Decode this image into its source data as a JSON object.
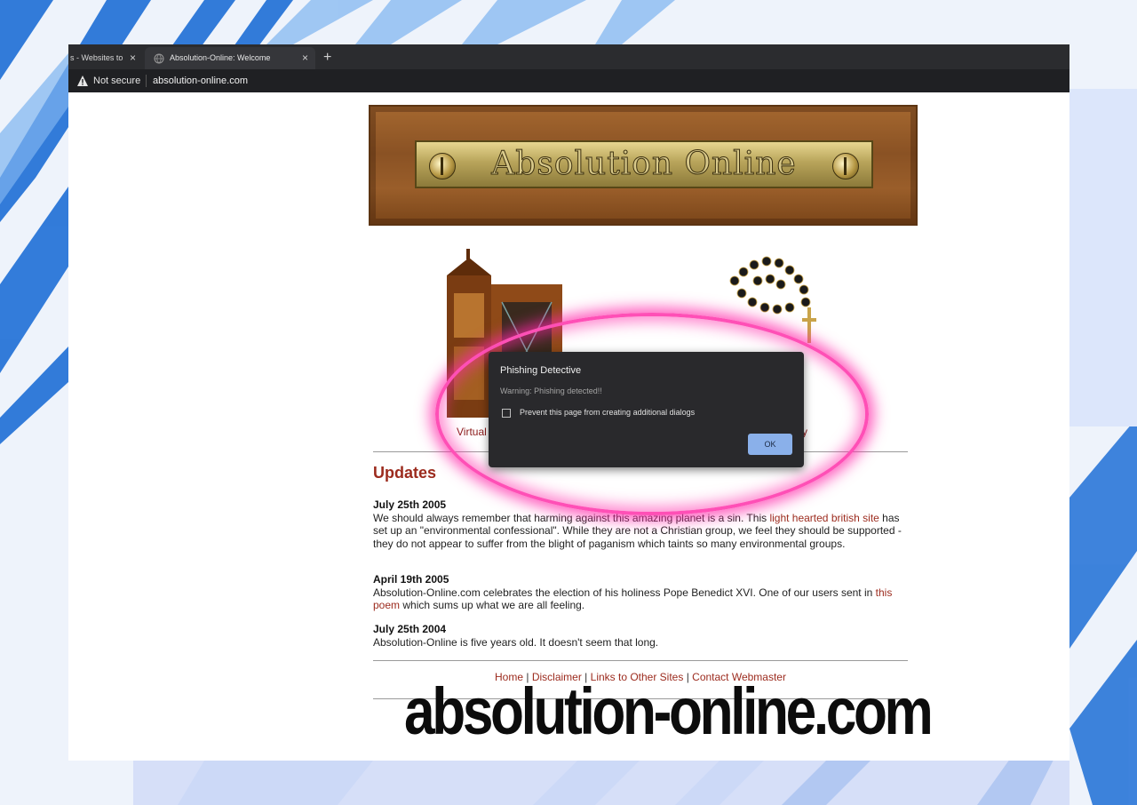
{
  "browser": {
    "tabs": [
      {
        "label": "s - Websites to",
        "active": false
      },
      {
        "label": "Absolution-Online: Welcome",
        "active": true
      }
    ],
    "new_tab_symbol": "+",
    "close_symbol": "×",
    "security_label": "Not secure",
    "url": "absolution-online.com"
  },
  "page": {
    "banner_title": "Absolution Online",
    "caption_left": "Virtual",
    "caption_right": "y",
    "updates_heading": "Updates",
    "entries": [
      {
        "date": "July 25th 2005",
        "text_before": "We should always remember that harming against this amazing planet is a sin. This ",
        "link": "light hearted british site",
        "text_after": " has set up an \"environmental confessional\". While they are not a Christian group, we feel they should be supported - they do not appear to suffer from the blight of paganism which taints so many environmental groups."
      },
      {
        "date": "April 19th 2005",
        "text_before": "Absolution-Online.com celebrates the election of his holiness Pope Benedict XVI. One of our users sent in ",
        "link": "this poem",
        "text_after": " which sums up what we are all feeling."
      },
      {
        "date": "July 25th 2004",
        "text_before": "Absolution-Online is five years old. It doesn't seem that long.",
        "link": "",
        "text_after": ""
      }
    ],
    "footer": {
      "home": "Home",
      "disclaimer": "Disclaimer",
      "links": "Links to Other Sites",
      "contact": "Contact Webmaster",
      "separator": " | "
    }
  },
  "dialog": {
    "title": "Phishing Detective",
    "message": "Warning: Phishing detected!!",
    "checkbox_label": "Prevent this page from creating additional dialogs",
    "ok_label": "OK"
  },
  "overlay_text": "absolution-online.com",
  "colors": {
    "highlight": "#ff4fb6",
    "link": "#9c2b1e",
    "dialog_bg": "#29292c",
    "ok_button": "#8ab0ea"
  }
}
